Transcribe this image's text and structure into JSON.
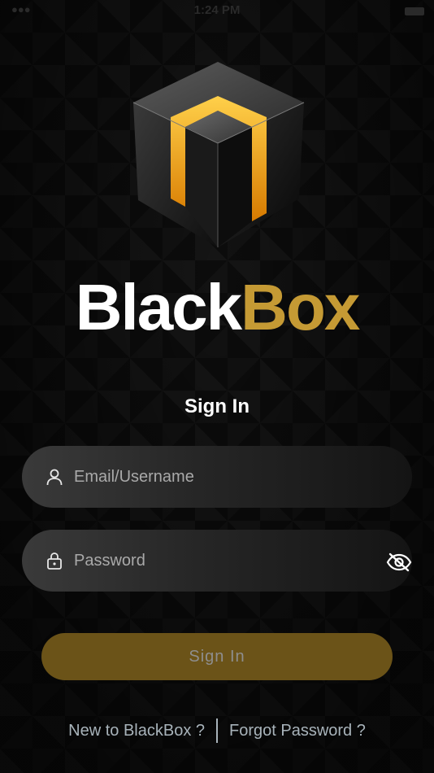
{
  "status_bar": {
    "time": "1:24 PM"
  },
  "brand": {
    "name_part1": "Black",
    "name_part2": "Box",
    "accent_color": "#c59a34"
  },
  "signin": {
    "title": "Sign In",
    "email_placeholder": "Email/Username",
    "email_value": "",
    "password_placeholder": "Password",
    "password_value": "",
    "button_label": "Sign In"
  },
  "links": {
    "new_account": "New to BlackBox ?",
    "forgot_password": "Forgot Password ?"
  },
  "icons": {
    "email": "user-icon",
    "password": "lock-icon",
    "visibility": "eye-slash-icon"
  }
}
